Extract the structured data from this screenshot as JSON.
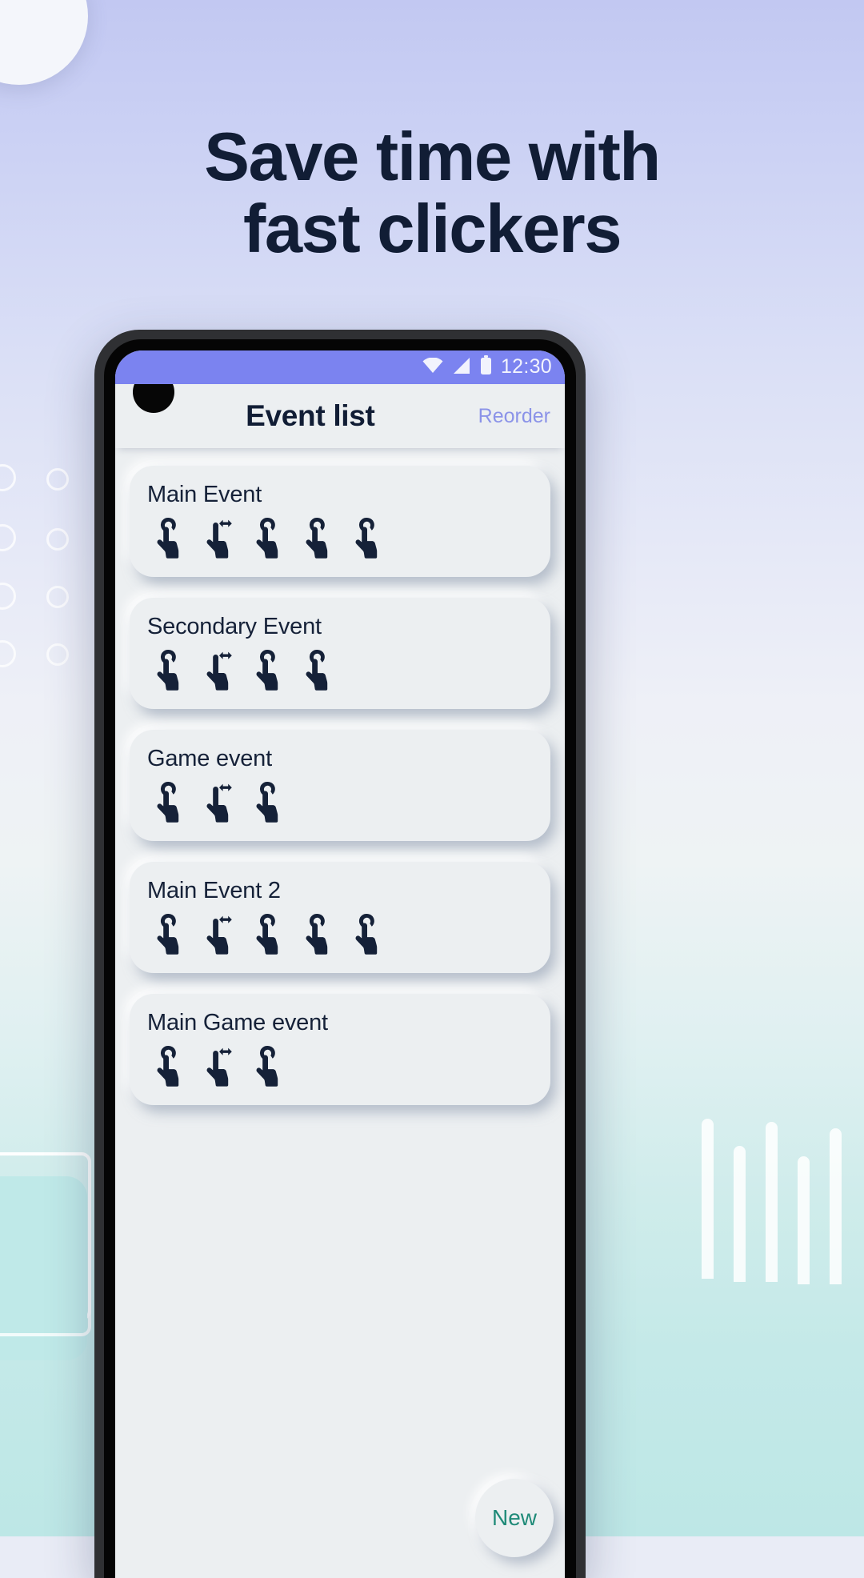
{
  "promo": {
    "headline_line1": "Save time with",
    "headline_line2": "fast clickers",
    "background_top_color": "#c2c8f2",
    "background_bottom_color": "#bde7e6",
    "headline_color": "#111d35"
  },
  "phone": {
    "status_bar": {
      "background_color": "#7b83f0",
      "clock": "12:30",
      "icons": [
        "wifi-icon",
        "cell-signal-icon",
        "battery-icon"
      ]
    },
    "app_bar": {
      "title": "Event list",
      "action_label": "Reorder",
      "action_color": "#8b93e8",
      "title_color": "#111d35"
    },
    "event_list": {
      "cards": [
        {
          "title": "Main Event",
          "gestures": [
            "tap",
            "swipe",
            "tap",
            "tap",
            "tap"
          ]
        },
        {
          "title": "Secondary Event",
          "gestures": [
            "tap",
            "swipe",
            "tap",
            "tap"
          ]
        },
        {
          "title": "Game event",
          "gestures": [
            "tap",
            "swipe",
            "tap"
          ]
        },
        {
          "title": "Main Event 2",
          "gestures": [
            "tap",
            "swipe",
            "tap",
            "tap",
            "tap"
          ]
        },
        {
          "title": "Main Game event",
          "gestures": [
            "tap",
            "swipe",
            "tap"
          ]
        }
      ]
    },
    "fab": {
      "label": "New",
      "color": "#1f8a78"
    }
  }
}
